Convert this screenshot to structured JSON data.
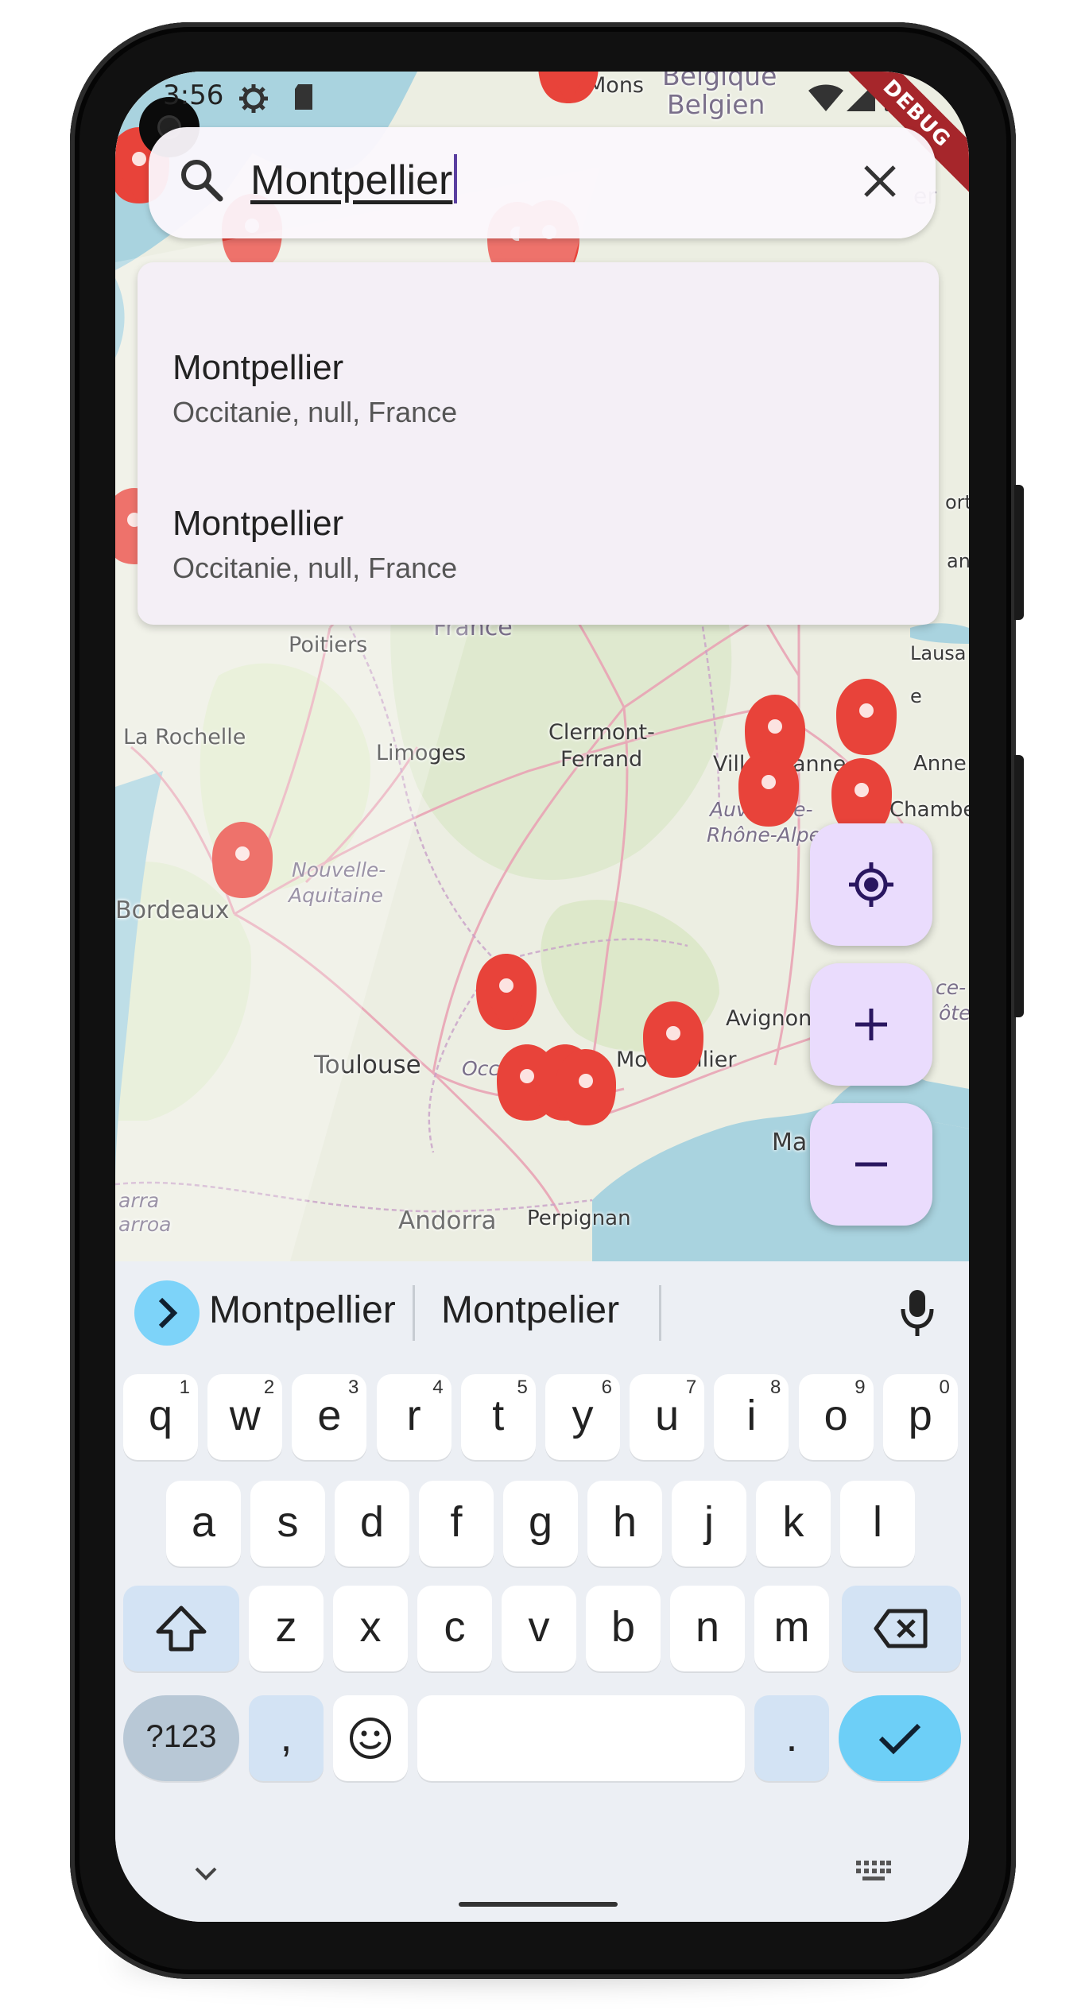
{
  "status_bar": {
    "time": "3:56",
    "debug_label": "DEBUG"
  },
  "search": {
    "query": "Montpellier"
  },
  "suggestions": [
    {
      "title": "Montpellier",
      "subtitle": "Occitanie, null, France"
    },
    {
      "title": "Montpellier",
      "subtitle": "Occitanie, null, France"
    }
  ],
  "map": {
    "labels": {
      "mons": "Mons",
      "belgique": "Belgique",
      "belgien": "Belgien",
      "france": "France",
      "poitiers": "Poitiers",
      "la_rochelle": "La Rochelle",
      "limoges": "Limoges",
      "clermont1": "Clermont-",
      "clermont2": "Ferrand",
      "ville": "Ville",
      "anne": "anne",
      "lausanne": "Lausa",
      "anne2": "Anne",
      "chambe": "Chambe",
      "auvergne": "Auvergne-",
      "rhone": "Rhône-Alpe",
      "bordeaux": "Bordeaux",
      "nouvelle": "Nouvelle-",
      "aquitaine": "Aquitaine",
      "toulouse": "Toulouse",
      "occ": "Occ",
      "montpellier": "Montpellier",
      "avignon": "Avignon",
      "ma": "Ma",
      "andorra": "Andorra",
      "perpignan": "Perpignan",
      "ce": "ce-",
      "cote": "ôte",
      "arra": "arra",
      "arroa": "arroa",
      "ort": "ort",
      "an": "an",
      "e": "e",
      "er": "er"
    }
  },
  "fabs": [
    "my-location-icon",
    "zoom-in-icon",
    "zoom-out-icon"
  ],
  "keyboard": {
    "suggestions": [
      "Montpellier",
      "Montpelier"
    ],
    "row1": [
      {
        "k": "q",
        "n": "1"
      },
      {
        "k": "w",
        "n": "2"
      },
      {
        "k": "e",
        "n": "3"
      },
      {
        "k": "r",
        "n": "4"
      },
      {
        "k": "t",
        "n": "5"
      },
      {
        "k": "y",
        "n": "6"
      },
      {
        "k": "u",
        "n": "7"
      },
      {
        "k": "i",
        "n": "8"
      },
      {
        "k": "o",
        "n": "9"
      },
      {
        "k": "p",
        "n": "0"
      }
    ],
    "row2": [
      "a",
      "s",
      "d",
      "f",
      "g",
      "h",
      "j",
      "k",
      "l"
    ],
    "row3": [
      "z",
      "x",
      "c",
      "v",
      "b",
      "n",
      "m"
    ],
    "symbols": "?123",
    "comma": ",",
    "period": "."
  },
  "colors": {
    "marker": "#e8433a",
    "fab_bg": "#eadcfd",
    "accent_blue": "#6dcff7",
    "water": "#a9d3df"
  }
}
